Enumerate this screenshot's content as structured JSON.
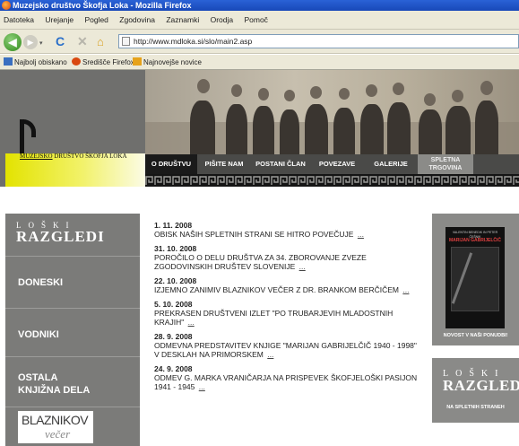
{
  "window": {
    "title": "Muzejsko društvo Škofja Loka - Mozilla Firefox"
  },
  "menu": [
    "Datoteka",
    "Urejanje",
    "Pogled",
    "Zgodovina",
    "Zaznamki",
    "Orodja",
    "Pomoč"
  ],
  "toolbar": {
    "back": "◀",
    "forward": "▶",
    "dropdown": "▾",
    "reload": "C",
    "stop": "✕",
    "home": "⌂",
    "url": "http://www.mdloka.si/slo/main2.asp"
  },
  "bookmarks": [
    {
      "label": "Najbolj obiskano",
      "icon": "most-visited-icon",
      "color": "#3a6fc0"
    },
    {
      "label": "Središče Firefox",
      "icon": "firefox-icon",
      "color": "#d9480f"
    },
    {
      "label": "Najnovejše novice",
      "icon": "rss-feed-icon",
      "color": "#e6a21a"
    }
  ],
  "site": {
    "logo_text_underlined": "MUZEJSKO",
    "logo_text_rest": " DRUŠTVO ŠKOFJA LOKA",
    "nav": [
      "O DRUŠTVU",
      "PIŠITE NAM",
      "POSTANI ČLAN",
      "POVEZAVE",
      "GALERIJE"
    ],
    "nav_spletna": [
      "SPLETNA",
      "TRGOVINA"
    ],
    "accent": "#e3e300"
  },
  "sidebar": {
    "loski_top": "LOŠKI",
    "loski_bottom": "RAZGLEDI",
    "items": [
      "DONESKI",
      "VODNIKI",
      "OSTALA",
      "KNJIŽNA DELA"
    ],
    "blaznikov": "BLAZNIKOV",
    "vecer": "večer"
  },
  "news": [
    {
      "date": "1. 11. 2008",
      "text": "OBISK NAŠIH SPLETNIH STRANI SE HITRO POVEČUJE",
      "more": "..."
    },
    {
      "date": "31. 10. 2008",
      "text": "POROČILO O DELU DRUŠTVA ZA 34. ZBOROVANJE ZVEZE ZGODOVINSKIH DRUŠTEV SLOVENIJE",
      "more": "..."
    },
    {
      "date": "22. 10. 2008",
      "text": "IZJEMNO ZANIMIV BLAZNIKOV VEČER Z DR. BRANKOM BERČIČEM",
      "more": "..."
    },
    {
      "date": "5. 10. 2008",
      "text": "PREKRASEN DRUŠTVENI IZLET \"PO TRUBARJEVIH MLADOSTNIH KRAJIH\"",
      "more": "..."
    },
    {
      "date": "28. 9. 2008",
      "text": "ODMEVNA PREDSTAVITEV KNJIGE \"MARIJAN GABRIJELČIČ 1940 - 1998\" V DESKLAH NA PRIMORSKEM",
      "more": "..."
    },
    {
      "date": "24. 9. 2008",
      "text": "ODMEV G. MARKA VRANIČARJA NA PRISPEVEK ŠKOFJELOŠKI PASIJON 1941 - 1945",
      "more": "..."
    }
  ],
  "right": {
    "book_top": "VALENTIN BENEDIK IN PETER ČEŠNIK",
    "book_name": "MARIJAN GABRIJELČIČ",
    "caption1": "NOVOST V NAŠI PONUDBI!",
    "loski_top": "LOŠKI",
    "loski_bottom": "RAZGLEDI",
    "caption2": "NA SPLETNIH STRANEH"
  }
}
